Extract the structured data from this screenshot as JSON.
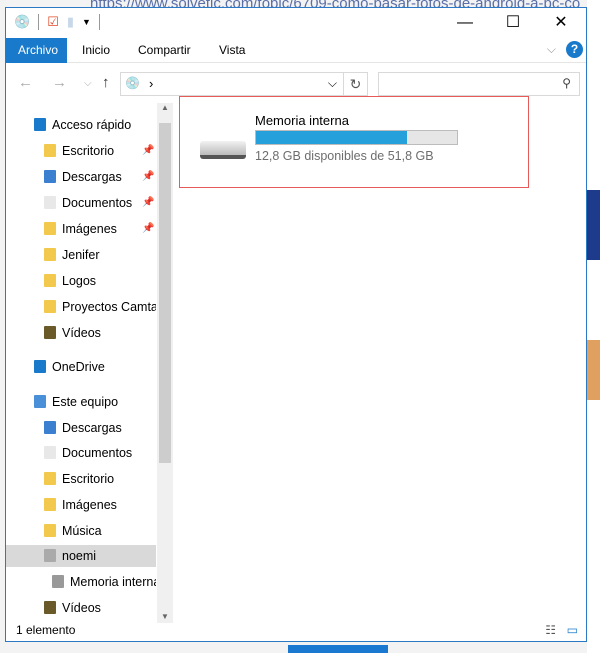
{
  "background": {
    "url_text": "https://www.solvetic.com/topic/6709-como-pasar-fotos-de-android-a-pc-co"
  },
  "window": {
    "controls": {
      "minimize": "—",
      "maximize": "☐",
      "close": "✕"
    },
    "ribbon": {
      "tabs": [
        "Archivo",
        "Inicio",
        "Compartir",
        "Vista"
      ],
      "help": "?"
    },
    "address": {
      "path_separator": "›"
    },
    "sidebar": {
      "items": [
        {
          "label": "Acceso rápido",
          "icon": "star-icon",
          "level": 0
        },
        {
          "label": "Escritorio",
          "icon": "folder-icon",
          "level": 1,
          "pinned": true
        },
        {
          "label": "Descargas",
          "icon": "downloads-icon",
          "level": 1,
          "pinned": true
        },
        {
          "label": "Documentos",
          "icon": "documents-icon",
          "level": 1,
          "pinned": true
        },
        {
          "label": "Imágenes",
          "icon": "pictures-icon",
          "level": 1,
          "pinned": true
        },
        {
          "label": "Jenifer",
          "icon": "folder-icon",
          "level": 1
        },
        {
          "label": "Logos",
          "icon": "folder-icon",
          "level": 1
        },
        {
          "label": "Proyectos Camtasia",
          "icon": "folder-icon",
          "level": 1
        },
        {
          "label": "Vídeos",
          "icon": "videos-icon",
          "level": 1
        },
        {
          "label": "OneDrive",
          "icon": "cloud-icon",
          "level": 0
        },
        {
          "label": "Este equipo",
          "icon": "computer-icon",
          "level": 0
        },
        {
          "label": "Descargas",
          "icon": "downloads-icon",
          "level": 1
        },
        {
          "label": "Documentos",
          "icon": "documents-icon",
          "level": 1
        },
        {
          "label": "Escritorio",
          "icon": "folder-icon",
          "level": 1
        },
        {
          "label": "Imágenes",
          "icon": "pictures-icon",
          "level": 1
        },
        {
          "label": "Música",
          "icon": "music-icon",
          "level": 1
        },
        {
          "label": "noemi",
          "icon": "device-icon",
          "level": 1,
          "selected": true
        },
        {
          "label": "Memoria interna",
          "icon": "drive-icon",
          "level": 2
        },
        {
          "label": "Vídeos",
          "icon": "videos-icon",
          "level": 1
        }
      ]
    },
    "drive": {
      "name": "Memoria interna",
      "used_fraction": 0.753,
      "info": "12,8 GB disponibles de 51,8 GB",
      "bar_color": "#26a0da"
    },
    "status": "1 elemento"
  }
}
